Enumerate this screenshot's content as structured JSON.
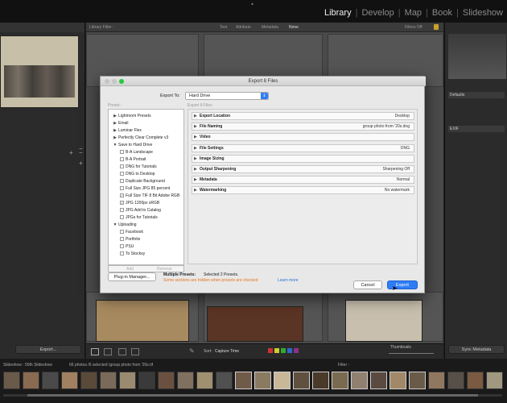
{
  "app": {
    "modules": [
      "Library",
      "Develop",
      "Map",
      "Book",
      "Slideshow"
    ],
    "active_module": "Library"
  },
  "library_filter": {
    "label": "Library Filter :",
    "tabs": [
      "Text",
      "Attribute",
      "Metadata",
      "None"
    ],
    "filters_off": "Filters Off"
  },
  "left_panel": {
    "export_button": "Export..."
  },
  "right_panel": {
    "defaults": "Defaults",
    "exif": "EXIF",
    "sync_metadata": "Sync Metadata"
  },
  "toolbar": {
    "sort_label": "Sort:",
    "sort_value": "Capture Time",
    "thumbnails_label": "Thumbnails"
  },
  "filmstrip": {
    "path": "Slideshow : 50th Slideshow",
    "info": "66 photos /6 selected /group photo from '20s.tif",
    "filter_label": "Filter :"
  },
  "dialog": {
    "title": "Export 8 Files",
    "export_to_label": "Export To:",
    "export_to_value": "Hard Drive",
    "preset_header": "Preset:",
    "section_header": "Export 8 Files",
    "presets": [
      {
        "label": "Lightroom Presets",
        "type": "folder",
        "open": false
      },
      {
        "label": "Email",
        "type": "folder",
        "open": false
      },
      {
        "label": "Luminar Flex",
        "type": "folder",
        "open": false
      },
      {
        "label": "Perfectly Clear Complete v3",
        "type": "folder",
        "open": false
      },
      {
        "label": "Save to Hard Drive",
        "type": "folder",
        "open": true
      },
      {
        "label": "B-A Landscape",
        "type": "item",
        "checked": false
      },
      {
        "label": "B-A Portrait",
        "type": "item",
        "checked": false
      },
      {
        "label": "DNG for Tutorials",
        "type": "item",
        "checked": false
      },
      {
        "label": "DNG to Desktop",
        "type": "item",
        "checked": false
      },
      {
        "label": "Duplicate Background",
        "type": "item",
        "checked": false
      },
      {
        "label": "Full Size JPG 85 percent",
        "type": "item",
        "checked": false
      },
      {
        "label": "Full Size TIF 8 Bit Adobe RGB",
        "type": "item",
        "checked": true
      },
      {
        "label": "JPG 1200px sRGB",
        "type": "item",
        "checked": true
      },
      {
        "label": "JPG Add to Catalog",
        "type": "item",
        "checked": false
      },
      {
        "label": "JPGs for Tutorials",
        "type": "item",
        "checked": false
      },
      {
        "label": "Uploading",
        "type": "folder",
        "open": true
      },
      {
        "label": "Facebook",
        "type": "item",
        "checked": false
      },
      {
        "label": "Portfolio",
        "type": "item",
        "checked": false
      },
      {
        "label": "PSU",
        "type": "item",
        "checked": false
      },
      {
        "label": "To Stocksy",
        "type": "item",
        "checked": false
      }
    ],
    "add_label": "Add",
    "remove_label": "Remove",
    "sections": [
      {
        "name": "Export Location",
        "value": "Desktop"
      },
      {
        "name": "File Naming",
        "value": "group photo from '20s.dng"
      },
      {
        "name": "Video",
        "value": ""
      },
      {
        "name": "File Settings",
        "value": "DNG"
      },
      {
        "name": "Image Sizing",
        "value": ""
      },
      {
        "name": "Output Sharpening",
        "value": "Sharpening Off"
      },
      {
        "name": "Metadata",
        "value": "Normal"
      },
      {
        "name": "Watermarking",
        "value": "No watermark"
      }
    ],
    "plugin_manager": "Plug-in Manager...",
    "multiple_presets": "Multiple Presets:",
    "selected_presets": "Selected 2 Presets.",
    "warning": "Some sections are hidden when presets are checked",
    "learn_more": "Learn more",
    "cancel": "Cancel",
    "export": "Export",
    "warning_color": "#e8761e",
    "accent_color": "#2f7cf6"
  }
}
